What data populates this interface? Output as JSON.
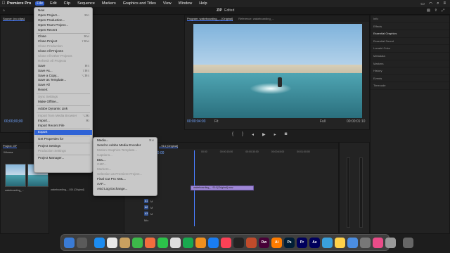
{
  "menubar": {
    "app_name": "Premiere Pro",
    "items": [
      "File",
      "Edit",
      "Clip",
      "Sequence",
      "Markers",
      "Graphics and Titles",
      "View",
      "Window",
      "Help"
    ]
  },
  "header": {
    "title_prefix": "ZIP",
    "title_suffix": "Edited"
  },
  "source_monitor": {
    "tab": "Source: (no clips)",
    "timecode": "00;00;00;00"
  },
  "program_monitor": {
    "tabs": [
      "Program: wakeboarding_... [Original]",
      "Reference: wakeboarding_..."
    ],
    "timecode": "00:00:04:03",
    "fit": "Fit",
    "quality": "Full",
    "duration": "00:00:01:10"
  },
  "right_panel": {
    "items": [
      "Info",
      "Effects",
      "Essential Graphics",
      "Essential Sound",
      "Lumetri Color",
      "Metadata",
      "Markers",
      "History",
      "Events",
      "Timecode"
    ]
  },
  "project": {
    "tab": "Project: GF",
    "bin": "Wivana",
    "thumb_labels": [
      "wakeboarding_...",
      "wakeboarding_...814 [Original]"
    ]
  },
  "timeline": {
    "tab": "...914 [Original]",
    "timecode": "00:00:00:00",
    "ruler": [
      "00:00",
      "00:00:15:00",
      "00:00:30:00",
      "00:00:45:00",
      "00:01:00:00",
      "00:01:15:00",
      "00:01:30:00",
      "00:01:45:00"
    ],
    "clip_label": "wakeboarding_...914 [Original].mov",
    "tracks": [
      "V1",
      "A1",
      "A2",
      "A3",
      "Mix"
    ]
  },
  "file_menu": [
    {
      "label": "New",
      "shortcut": "",
      "disabled": false
    },
    {
      "label": "Open Project...",
      "shortcut": "⌘O",
      "disabled": false
    },
    {
      "label": "Open Production...",
      "shortcut": "",
      "disabled": false
    },
    {
      "label": "Open Team Project...",
      "shortcut": "",
      "disabled": false
    },
    {
      "label": "Open Recent",
      "shortcut": "",
      "disabled": false
    },
    {
      "sep": true
    },
    {
      "label": "Close",
      "shortcut": "⌘W",
      "disabled": false
    },
    {
      "label": "Close Project",
      "shortcut": "⇧⌘W",
      "disabled": false
    },
    {
      "label": "Close Production",
      "shortcut": "",
      "disabled": true
    },
    {
      "label": "Close All Projects",
      "shortcut": "",
      "disabled": false
    },
    {
      "label": "Close All Other Projects",
      "shortcut": "",
      "disabled": true
    },
    {
      "label": "Refresh All Projects",
      "shortcut": "",
      "disabled": true
    },
    {
      "label": "Save",
      "shortcut": "⌘S",
      "disabled": false
    },
    {
      "label": "Save As...",
      "shortcut": "⇧⌘S",
      "disabled": false
    },
    {
      "label": "Save a Copy...",
      "shortcut": "⌥⌘S",
      "disabled": false
    },
    {
      "label": "Save as Template...",
      "shortcut": "",
      "disabled": false
    },
    {
      "label": "Save All",
      "shortcut": "",
      "disabled": false
    },
    {
      "label": "Revert",
      "shortcut": "",
      "disabled": false
    },
    {
      "sep": true
    },
    {
      "label": "Sync Settings",
      "shortcut": "",
      "disabled": true
    },
    {
      "label": "Make Offline...",
      "shortcut": "",
      "disabled": false
    },
    {
      "sep": true
    },
    {
      "label": "Adobe Dynamic Link",
      "shortcut": "",
      "disabled": false
    },
    {
      "sep": true
    },
    {
      "label": "Import from Media Browser",
      "shortcut": "⌥⌘I",
      "disabled": true
    },
    {
      "label": "Import...",
      "shortcut": "⌘I",
      "disabled": false
    },
    {
      "label": "Import Recent File",
      "shortcut": "",
      "disabled": false
    },
    {
      "sep": true
    },
    {
      "label": "Export",
      "shortcut": "",
      "disabled": false,
      "highlighted": true
    },
    {
      "sep": true
    },
    {
      "label": "Get Properties for",
      "shortcut": "",
      "disabled": false
    },
    {
      "sep": true
    },
    {
      "label": "Project Settings",
      "shortcut": "",
      "disabled": false
    },
    {
      "label": "Production Settings",
      "shortcut": "",
      "disabled": true
    },
    {
      "sep": true
    },
    {
      "label": "Project Manager...",
      "shortcut": "",
      "disabled": false
    }
  ],
  "export_menu": [
    {
      "label": "Media...",
      "shortcut": "⌘M",
      "disabled": false
    },
    {
      "label": "Send to Adobe Media Encoder",
      "shortcut": "",
      "disabled": false
    },
    {
      "label": "Motion Graphics Template...",
      "shortcut": "",
      "disabled": true
    },
    {
      "label": "Captions...",
      "shortcut": "",
      "disabled": true
    },
    {
      "label": "EDL...",
      "shortcut": "",
      "disabled": false
    },
    {
      "label": "OMF...",
      "shortcut": "",
      "disabled": true
    },
    {
      "label": "Markers...",
      "shortcut": "",
      "disabled": true
    },
    {
      "label": "Selection as Premiere Project...",
      "shortcut": "",
      "disabled": true
    },
    {
      "label": "Final Cut Pro XML...",
      "shortcut": "",
      "disabled": false
    },
    {
      "label": "AAF...",
      "shortcut": "",
      "disabled": false
    },
    {
      "label": "Avid Log Exchange...",
      "shortcut": "",
      "disabled": false
    }
  ],
  "dock": [
    {
      "label": "",
      "color": "#3a7bd5"
    },
    {
      "label": "",
      "color": "#5a5a5a"
    },
    {
      "label": "",
      "color": "#1c8cf0"
    },
    {
      "label": "",
      "color": "#e8e8e8"
    },
    {
      "label": "",
      "color": "#c8a060"
    },
    {
      "label": "",
      "color": "#3db94a"
    },
    {
      "label": "",
      "color": "#f26d3d"
    },
    {
      "label": "",
      "color": "#2cc24a"
    },
    {
      "label": "",
      "color": "#ddd"
    },
    {
      "label": "",
      "color": "#19a94f"
    },
    {
      "label": "",
      "color": "#f08f1e"
    },
    {
      "label": "",
      "color": "#1a7df2"
    },
    {
      "label": "",
      "color": "#fb4156"
    },
    {
      "label": "",
      "color": "#222"
    },
    {
      "label": "",
      "color": "#c04b2b"
    },
    {
      "label": "Dw",
      "color": "#470137"
    },
    {
      "label": "Ai",
      "color": "#ff7c00"
    },
    {
      "label": "Ps",
      "color": "#001e36"
    },
    {
      "label": "Pr",
      "color": "#00005b"
    },
    {
      "label": "Ae",
      "color": "#00005b"
    },
    {
      "label": "",
      "color": "#3aa0dc"
    },
    {
      "label": "",
      "color": "#ffd24a"
    },
    {
      "label": "",
      "color": "#4b8de0"
    },
    {
      "label": "",
      "color": "#777"
    },
    {
      "label": "",
      "color": "#ea4c89"
    },
    {
      "label": "",
      "color": "#999"
    },
    {
      "label": "",
      "color": "#666"
    }
  ]
}
